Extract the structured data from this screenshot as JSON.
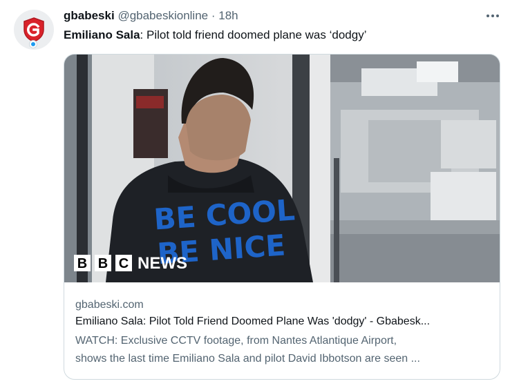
{
  "tweet": {
    "author_name": "gbabeski",
    "author_handle": "@gbabeskionline",
    "separator": "·",
    "time": "18h",
    "text_bold": "Emiliano Sala",
    "text_rest": ": Pilot told friend doomed plane was ‘dodgy’",
    "avatar_icon": "g-shield-logo-icon",
    "more_icon": "more-horizontal-icon"
  },
  "card": {
    "image_overlay": {
      "sweater_text_line1": "BE COOL",
      "sweater_text_line2": "BE NICE",
      "news_blocks": [
        "B",
        "B",
        "C"
      ],
      "news_word": "NEWS"
    },
    "domain": "gbabeski.com",
    "title": "Emiliano Sala: Pilot Told Friend Doomed Plane Was 'dodgy' - Gbabesk...",
    "description_line1": "WATCH: Exclusive CCTV footage, from Nantes Atlantique Airport,",
    "description_line2": "shows the last time Emiliano Sala and pilot David Ibbotson are seen ..."
  },
  "colors": {
    "text_primary": "#0f1419",
    "text_secondary": "#536471",
    "border": "#cfd9de",
    "logo_red": "#d9222a",
    "sweater_blue": "#1e64c8"
  }
}
